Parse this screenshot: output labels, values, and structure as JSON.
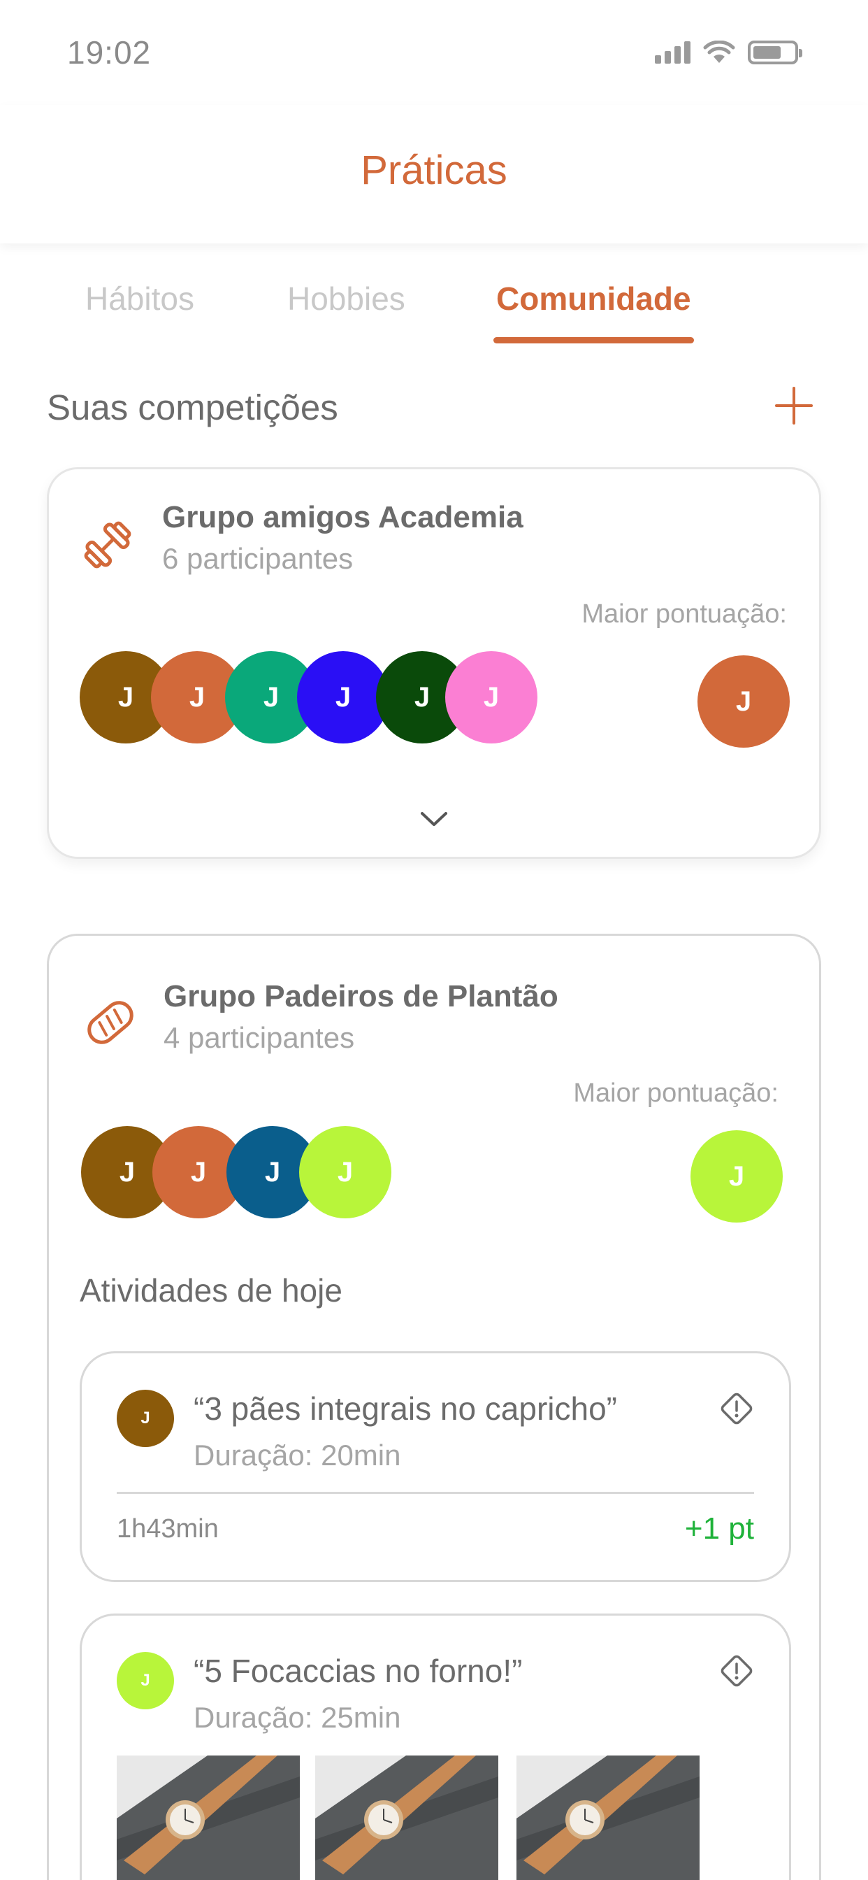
{
  "status_bar": {
    "time": "19:02"
  },
  "header": {
    "title": "Práticas"
  },
  "tabs": [
    {
      "label": "Hábitos",
      "active": false
    },
    {
      "label": "Hobbies",
      "active": false
    },
    {
      "label": "Comunidade",
      "active": true
    }
  ],
  "section": {
    "title": "Suas competições",
    "add_icon": "plus-icon"
  },
  "competitions": [
    {
      "name": "Grupo amigos Academia",
      "participants": "6 participantes",
      "icon": "dumbbell-icon",
      "best_label": "Maior pontuação:",
      "avatars": [
        {
          "initial": "J",
          "color": "#8b5a0a"
        },
        {
          "initial": "J",
          "color": "#d2693a"
        },
        {
          "initial": "J",
          "color": "#0aa87a"
        },
        {
          "initial": "J",
          "color": "#2a0ff5"
        },
        {
          "initial": "J",
          "color": "#0a4a0a"
        },
        {
          "initial": "J",
          "color": "#fb7fd3"
        }
      ],
      "top_scorer": {
        "initial": "J",
        "color": "#d2693a"
      },
      "expand_icon": "chevron-down-icon"
    },
    {
      "name": "Grupo Padeiros de Plantão",
      "participants": "4 participantes",
      "icon": "bread-icon",
      "best_label": "Maior pontuação:",
      "avatars": [
        {
          "initial": "J",
          "color": "#8b5a0a"
        },
        {
          "initial": "J",
          "color": "#d2693a"
        },
        {
          "initial": "J",
          "color": "#0a5e8c"
        },
        {
          "initial": "J",
          "color": "#b8f53a"
        }
      ],
      "top_scorer": {
        "initial": "J",
        "color": "#b8f53a"
      },
      "activities_heading": "Atividades de hoje",
      "activities": [
        {
          "user_initial": "J",
          "user_color": "#8b5a0a",
          "title": "“3 pães integrais no capricho”",
          "duration": "Duração: 20min",
          "elapsed": "1h43min",
          "points": "+1 pt",
          "report_icon": "warning-diamond-icon"
        },
        {
          "user_initial": "J",
          "user_color": "#b8f53a",
          "title": "“5 Focaccias no forno!”",
          "duration": "Duração: 25min",
          "report_icon": "warning-diamond-icon",
          "photos": [
            "watch-photo",
            "watch-photo",
            "watch-photo"
          ]
        }
      ]
    }
  ],
  "colors": {
    "accent": "#d2693a",
    "points_green": "#1fb23a"
  }
}
